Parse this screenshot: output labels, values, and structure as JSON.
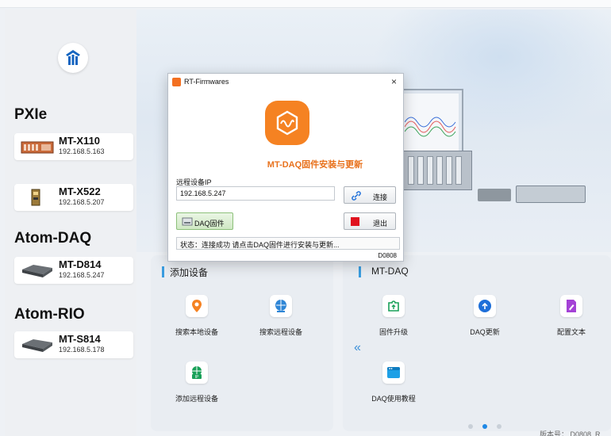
{
  "sidebar": {
    "categories": [
      "PXIe",
      "Atom-DAQ",
      "Atom-RIO"
    ],
    "devices": [
      {
        "name": "MT-X110",
        "ip": "192.168.5.163"
      },
      {
        "name": "MT-X522",
        "ip": "192.168.5.207"
      },
      {
        "name": "MT-D814",
        "ip": "192.168.5.247"
      },
      {
        "name": "MT-S814",
        "ip": "192.168.5.178"
      }
    ]
  },
  "add_panel": {
    "title": "添加设备",
    "tiles": [
      "搜索本地设备",
      "搜索远程设备",
      "添加远程设备"
    ]
  },
  "daq_panel": {
    "title": "MT-DAQ",
    "tiles": [
      "固件升级",
      "DAQ更新",
      "配置文本",
      "DAQ使用教程"
    ],
    "prev": "«"
  },
  "pager": {
    "count": 3,
    "active": 2
  },
  "version": "版本号： D0808_R..",
  "dialog": {
    "title": "RT-Firmwares",
    "close": "×",
    "heading": "MT-DAQ固件安装与更新",
    "ip_label": "远程设备IP",
    "ip_value": "192.168.5.247",
    "connect_label": "连接",
    "daq_fw_label": "DAQ固件",
    "exit_label": "退出",
    "status": "状态：连接成功 请点击DAQ固件进行安装与更新...",
    "code": "D0808"
  },
  "colors": {
    "accent": "#1e88e5",
    "brand": "#f58222",
    "exit": "#e0121f"
  }
}
